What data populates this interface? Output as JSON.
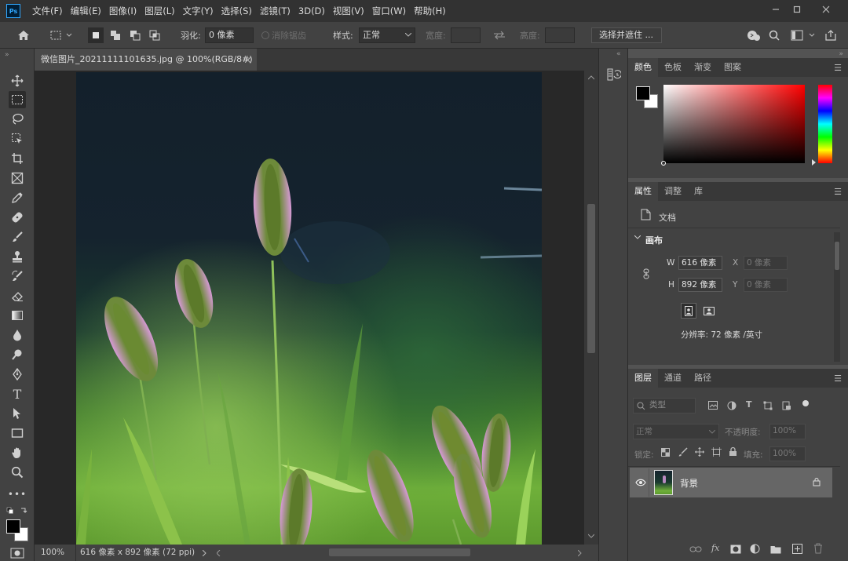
{
  "app": {
    "logo_text": "Ps",
    "menu": [
      "文件(F)",
      "编辑(E)",
      "图像(I)",
      "图层(L)",
      "文字(Y)",
      "选择(S)",
      "滤镜(T)",
      "3D(D)",
      "视图(V)",
      "窗口(W)",
      "帮助(H)"
    ]
  },
  "options": {
    "feather_label": "羽化:",
    "feather_value": "0 像素",
    "antialias_label": "消除锯齿",
    "style_label": "样式:",
    "style_value": "正常",
    "width_label": "宽度:",
    "height_label": "高度:",
    "select_mask_button": "选择并遮住 ..."
  },
  "document": {
    "tab_title": "微信图片_20211111101635.jpg @ 100%(RGB/8#)",
    "zoom": "100%",
    "status_info": "616 像素 x 892 像素 (72 ppi)"
  },
  "color_panel": {
    "tabs": [
      "颜色",
      "色板",
      "渐变",
      "图案"
    ],
    "foreground": "#000000",
    "background": "#ffffff",
    "hue": "#ff0000"
  },
  "properties_panel": {
    "tabs": [
      "属性",
      "调整",
      "库"
    ],
    "doc_label": "文档",
    "section_canvas": "画布",
    "w_label": "W",
    "w_value": "616 像素",
    "h_label": "H",
    "h_value": "892 像素",
    "x_label": "X",
    "x_value": "0 像素",
    "y_label": "Y",
    "y_value": "0 像素",
    "resolution": "分辨率: 72 像素 /英寸"
  },
  "layers_panel": {
    "tabs": [
      "图层",
      "通道",
      "路径"
    ],
    "filter_kind": "类型",
    "blend_mode": "正常",
    "opacity_label": "不透明度:",
    "opacity_value": "100%",
    "lock_label": "锁定:",
    "fill_label": "填充:",
    "fill_value": "100%",
    "layers": [
      {
        "name": "背景",
        "visible": true,
        "locked": true
      }
    ]
  }
}
